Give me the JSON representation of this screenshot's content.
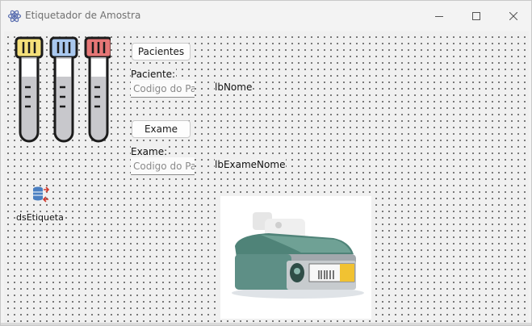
{
  "window": {
    "title": "Etiquetador de Amostra"
  },
  "controls": {
    "pacientes_button": "Pacientes",
    "paciente_label": "Paciente:",
    "paciente_input_placeholder": "Codigo do Paciente",
    "lb_nome": "lbNome",
    "exame_button": "Exame",
    "exame_label": "Exame:",
    "exame_input_placeholder": "Codigo do Paciente",
    "lb_exame_nome": "lbExameNome"
  },
  "dataset": {
    "label": "dsEtiqueta",
    "icon": "database-icon"
  },
  "icons": {
    "app": "app-icon",
    "tubes": "test-tubes-icon",
    "printer": "label-printer-icon"
  },
  "colors": {
    "tube_yellow": "#f5e07a",
    "tube_blue": "#a9c8ef",
    "tube_red": "#e67676",
    "printer_body": "#5e8f86"
  }
}
